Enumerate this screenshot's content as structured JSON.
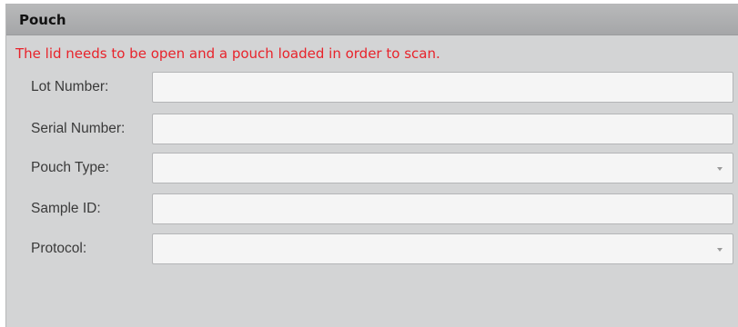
{
  "panel": {
    "title": "Pouch",
    "warning": "The lid needs to be open and a pouch loaded in order to scan."
  },
  "fields": {
    "lot_number": {
      "label": "Lot Number:",
      "value": ""
    },
    "serial_number": {
      "label": "Serial Number:",
      "value": ""
    },
    "pouch_type": {
      "label": "Pouch Type:",
      "selected": ""
    },
    "sample_id": {
      "label": "Sample ID:",
      "value": ""
    },
    "protocol": {
      "label": "Protocol:",
      "selected": ""
    }
  },
  "colors": {
    "warning": "#e8232b",
    "panel_bg": "#d3d4d5",
    "header_bg": "#a5a6a8",
    "field_bg": "#f5f5f5"
  },
  "icons": {
    "dropdown": "chevron-down-icon"
  }
}
